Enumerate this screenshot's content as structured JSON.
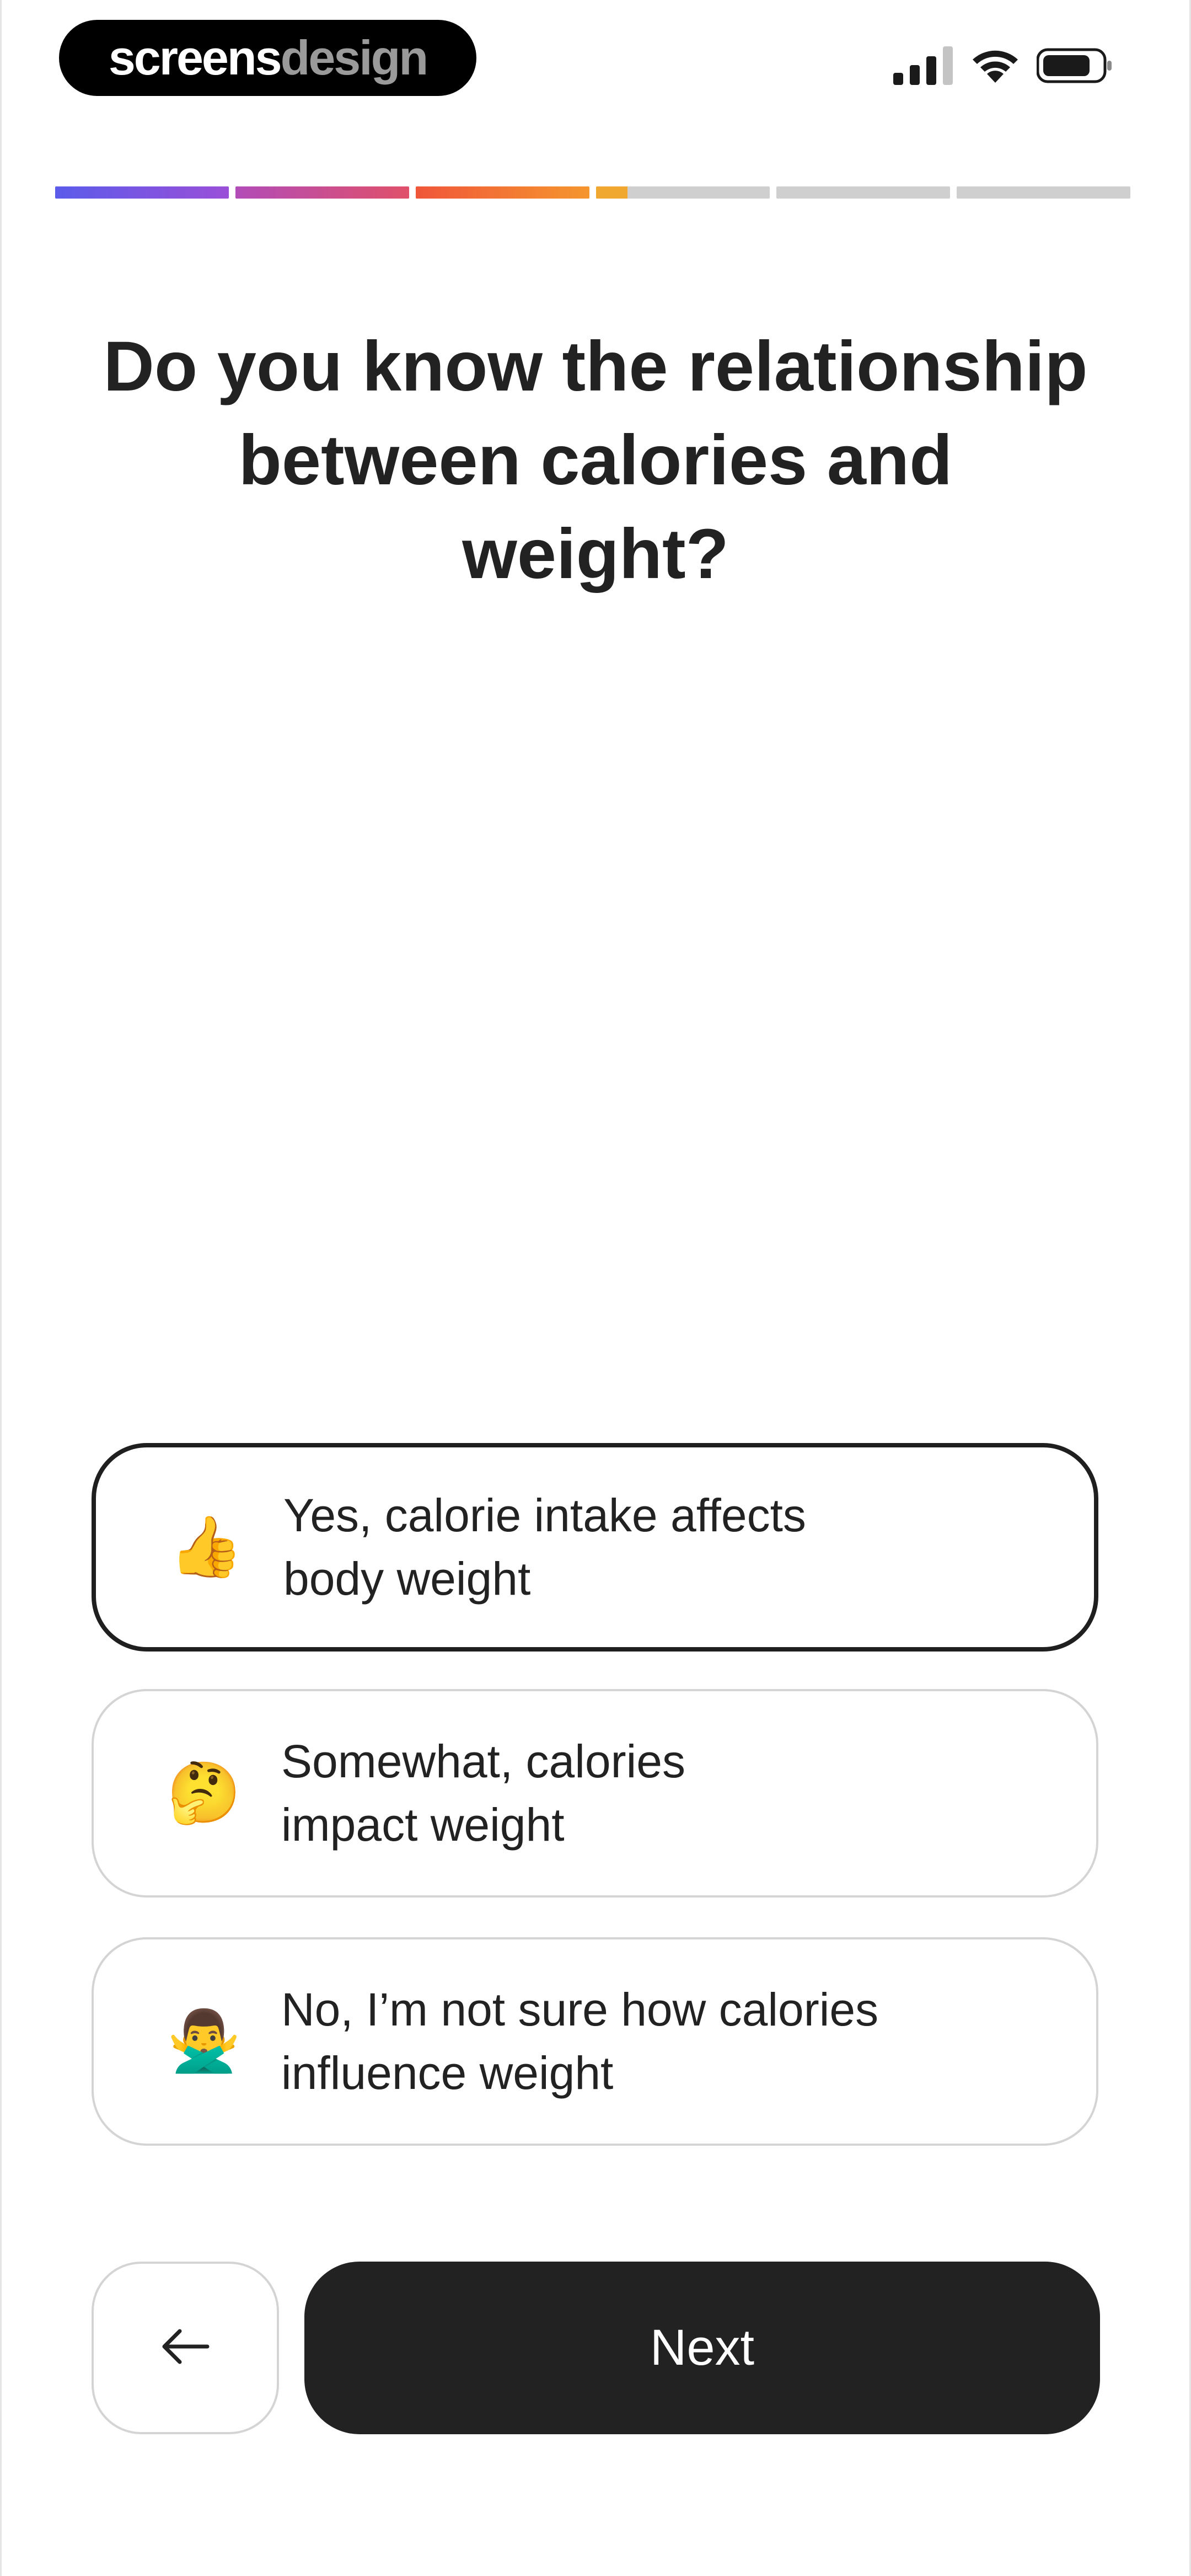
{
  "status_bar": {
    "brand_part1": "screens",
    "brand_part2": "design",
    "signal_icon": "cellular-signal-icon",
    "wifi_icon": "wifi-icon",
    "battery_icon": "battery-icon"
  },
  "progress": {
    "total_steps": 6,
    "segment_fill": [
      1,
      1,
      1,
      0.18,
      0,
      0
    ],
    "segment_colors": [
      "#5b5bea",
      "#c0469a",
      "#f06a3a",
      "#f0a830",
      "#cfcfcf",
      "#cfcfcf"
    ]
  },
  "question": {
    "line1": "Do you know the relationship",
    "line2": "between calories and",
    "line3": "weight?"
  },
  "options": [
    {
      "emoji": "👍",
      "emoji_icon": "thumbs-up-icon",
      "line1": "Yes, calorie intake affects",
      "line2": "body weight",
      "selected": true
    },
    {
      "emoji": "🤔",
      "emoji_icon": "thinking-face-icon",
      "line1": "Somewhat, calories",
      "line2": "impact weight",
      "selected": false
    },
    {
      "emoji": "🙅‍♂️",
      "emoji_icon": "no-gesture-icon",
      "line1": "No, I’m not sure how calories",
      "line2": "influence weight",
      "selected": false
    }
  ],
  "navigation": {
    "back_icon": "arrow-left-icon",
    "next_label": "Next"
  },
  "colors": {
    "text": "#222222",
    "button_dark": "#222222",
    "border_light": "#d4d4d4",
    "border_selected": "#1f1f1f"
  }
}
